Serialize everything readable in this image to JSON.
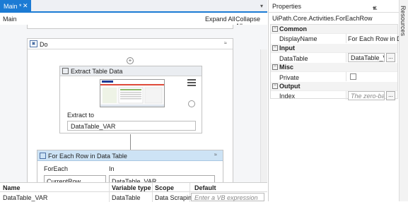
{
  "designer": {
    "tab_label": "Main *",
    "tab_close": "✕",
    "tab_menu": "▾",
    "breadcrumb": "Main",
    "expand_all": "Expand All",
    "collapse_all": "Collapse All"
  },
  "do_sequence": {
    "title": "Do",
    "collapse_glyph": "≈"
  },
  "add_glyph": "+",
  "extract_table": {
    "title": "Extract Table Data",
    "extract_to_label": "Extract to",
    "extract_to_value": "DataTable_VAR"
  },
  "for_each": {
    "title": "For Each Row in Data Table",
    "collapse_glyph": "≈",
    "foreach_label": "ForEach",
    "in_label": "In",
    "foreach_value": "CurrentRow",
    "in_value": "DataTable_VAR"
  },
  "variables": {
    "headers": {
      "name": "Name",
      "type": "Variable type",
      "scope": "Scope",
      "default": "Default"
    },
    "rows": [
      {
        "name": "DataTable_VAR",
        "type": "DataTable",
        "scope": "Data Scraping",
        "default_placeholder": "Enter a VB expression"
      }
    ]
  },
  "properties": {
    "panel_title": "Properties",
    "activity_type": "UiPath.Core.Activities.ForEachRow",
    "sections": [
      {
        "name": "Common",
        "rows": [
          {
            "label": "DisplayName",
            "value": "For Each Row in D"
          }
        ]
      },
      {
        "name": "Input",
        "rows": [
          {
            "label": "DataTable",
            "value": "DataTable_VAR"
          }
        ]
      },
      {
        "name": "Misc",
        "rows": [
          {
            "label": "Private",
            "checked": false
          }
        ]
      },
      {
        "name": "Output",
        "rows": [
          {
            "label": "Index",
            "placeholder": "The zero-bas"
          }
        ]
      }
    ],
    "ellipsis": "...",
    "toggle_glyph": "−"
  },
  "side_tab": "Resources"
}
